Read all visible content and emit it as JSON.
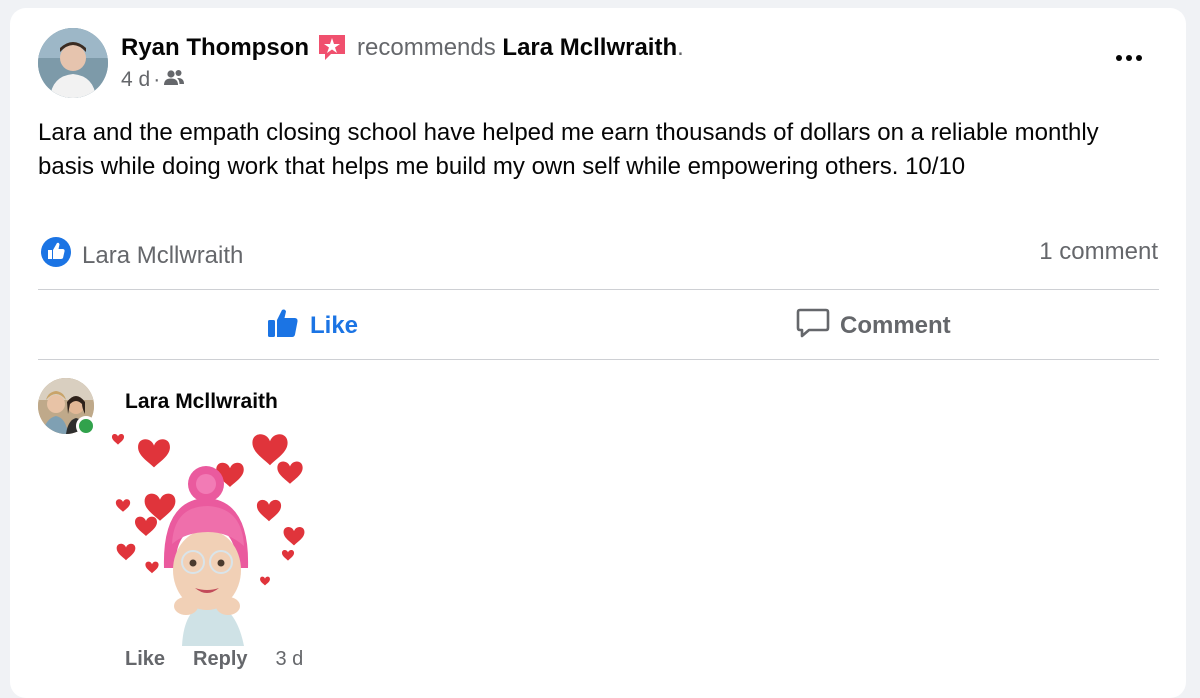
{
  "post": {
    "author": "Ryan Thompson",
    "recommends_text": "recommends",
    "recommended_name": "Lara Mcllwraith",
    "period": ".",
    "time": "4 d",
    "separator": "·",
    "audience_icon": "friends-icon",
    "text": "Lara and the empath closing school have helped me earn thousands of dollars on a reliable monthly basis while doing work that helps me build my own self while empowering others. 10/10",
    "reaction_names": "Lara Mcllwraith",
    "comment_count": "1 comment"
  },
  "actions": {
    "like": "Like",
    "comment": "Comment"
  },
  "comment": {
    "author": "Lara Mcllwraith",
    "like": "Like",
    "reply": "Reply",
    "time": "3 d"
  },
  "colors": {
    "accent": "#1b74e4",
    "secondary_text": "#65676b",
    "badge": "#f0506e",
    "heart": "#e0343b",
    "online": "#31a24c"
  }
}
